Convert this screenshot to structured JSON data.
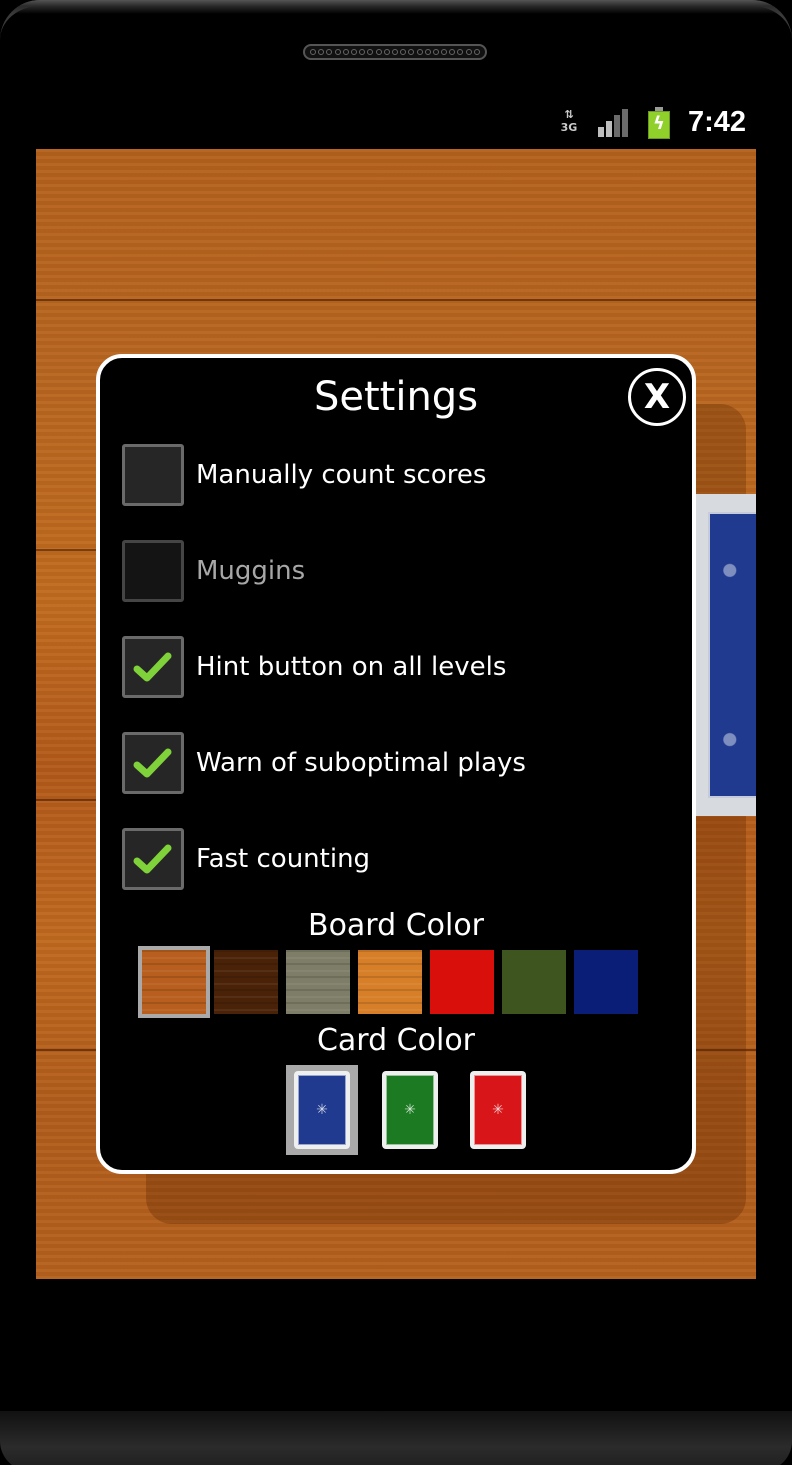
{
  "status_bar": {
    "network_icon": "3g-data-icon",
    "network_label": "3G",
    "signal_icon": "signal-strength-icon",
    "signal_bars_lit": 2,
    "signal_bars_total": 4,
    "battery_icon": "battery-charging-icon",
    "time": "7:42"
  },
  "dialog": {
    "title": "Settings",
    "close_label": "X",
    "options": [
      {
        "label": "Manually count scores",
        "checked": false,
        "enabled": true
      },
      {
        "label": "Muggins",
        "checked": false,
        "enabled": false
      },
      {
        "label": "Hint button on all levels",
        "checked": true,
        "enabled": true
      },
      {
        "label": "Warn of suboptimal plays",
        "checked": true,
        "enabled": true
      },
      {
        "label": "Fast counting",
        "checked": true,
        "enabled": true
      }
    ],
    "board_color": {
      "title": "Board Color",
      "selected_index": 0,
      "swatches": [
        {
          "name": "light-wood",
          "color": "#b85e1e"
        },
        {
          "name": "dark-wood",
          "color": "#4a2208"
        },
        {
          "name": "gray-wood",
          "color": "#7d7d68"
        },
        {
          "name": "orange-wood",
          "color": "#d77e28"
        },
        {
          "name": "red-felt",
          "color": "#d90f0b"
        },
        {
          "name": "green-felt",
          "color": "#3e5520"
        },
        {
          "name": "blue-felt",
          "color": "#0a1e78"
        }
      ]
    },
    "card_color": {
      "title": "Card Color",
      "selected_index": 0,
      "cards": [
        {
          "name": "blue",
          "color": "#1f3a8e"
        },
        {
          "name": "green",
          "color": "#1c7a22"
        },
        {
          "name": "red",
          "color": "#d8161a"
        }
      ]
    }
  },
  "colors": {
    "check_green": "#7fd23a",
    "dialog_border": "#ffffff",
    "disabled_text": "#a7a7a7"
  }
}
